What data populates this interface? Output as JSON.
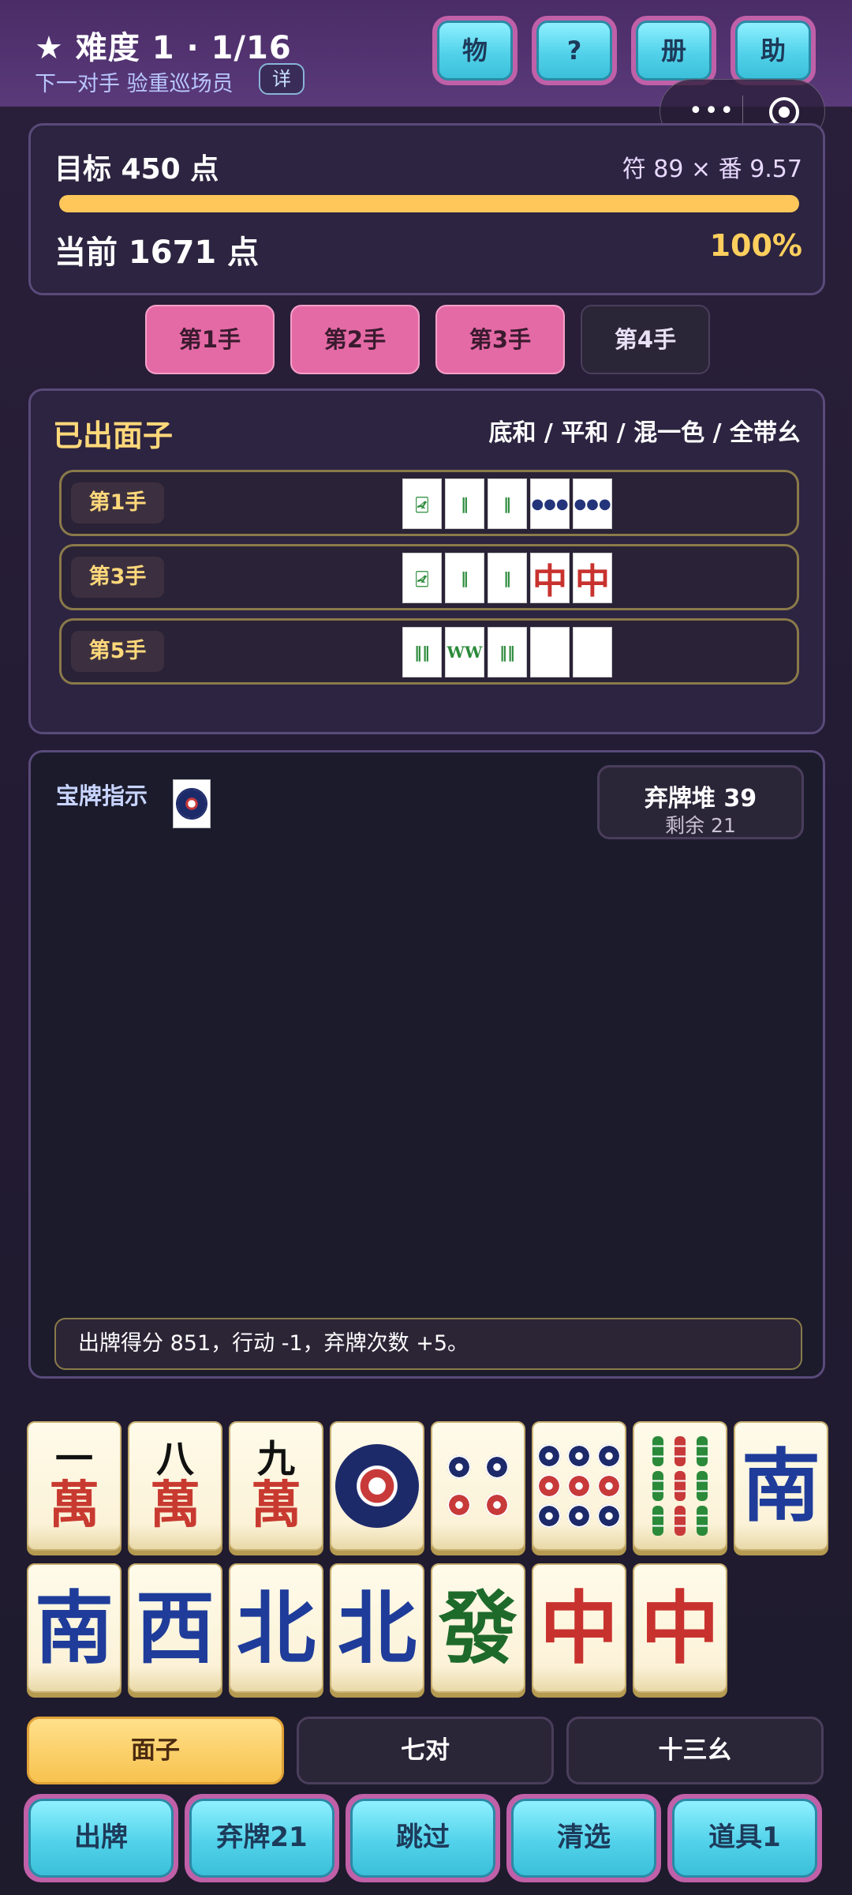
{
  "header": {
    "title": "★ 难度 1 · 1/16",
    "subtitle": "下一对手 验重巡场员",
    "detail_badge": "详",
    "buttons": [
      "物",
      "?",
      "册",
      "助"
    ]
  },
  "score": {
    "goal": "目标 450 点",
    "formula": "符 89 × 番 9.57",
    "current": "当前 1671 点",
    "percent": "100%",
    "progress_fraction": 1.0,
    "progress_color": "#ffc75a"
  },
  "hand_tabs": [
    {
      "label": "第1手",
      "active": true
    },
    {
      "label": "第2手",
      "active": true
    },
    {
      "label": "第3手",
      "active": true
    },
    {
      "label": "第4手",
      "active": false
    }
  ],
  "melds": {
    "title": "已出面子",
    "yaku": "底和 / 平和 / 混一色 / 全带幺",
    "rows": [
      {
        "hand": "第1手",
        "tiles": [
          "bamboo-1",
          "bamboo-2",
          "bamboo-2",
          "circle-9",
          "circle-9"
        ]
      },
      {
        "hand": "第3手",
        "tiles": [
          "bamboo-1",
          "bamboo-2",
          "bamboo-2",
          "中",
          "中"
        ]
      },
      {
        "hand": "第5手",
        "tiles": [
          "bamboo-6",
          "bamboo-8",
          "bamboo-7",
          "white-dragon",
          "white-dragon"
        ]
      }
    ]
  },
  "discard": {
    "dora_label": "宝牌指示",
    "pile_main": "弃牌堆 39",
    "pile_sub": "剩余 21",
    "log": "出牌得分 851，行动 -1，弃牌次数 +5。"
  },
  "hand": {
    "row1": [
      {
        "kind": "man",
        "num": "一",
        "suit": "萬"
      },
      {
        "kind": "man",
        "num": "八",
        "suit": "萬"
      },
      {
        "kind": "man",
        "num": "九",
        "suit": "萬"
      },
      {
        "kind": "circle1",
        "name": "circle-1"
      },
      {
        "kind": "circle4",
        "name": "circle-4"
      },
      {
        "kind": "circle9",
        "name": "circle-9"
      },
      {
        "kind": "bamboo9",
        "name": "bamboo-9"
      },
      {
        "kind": "honor",
        "text": "南",
        "color": "blue"
      }
    ],
    "row2": [
      {
        "kind": "honor",
        "text": "南",
        "color": "blue"
      },
      {
        "kind": "honor",
        "text": "西",
        "color": "blue"
      },
      {
        "kind": "honor",
        "text": "北",
        "color": "blue"
      },
      {
        "kind": "honor",
        "text": "北",
        "color": "blue"
      },
      {
        "kind": "honor",
        "text": "發",
        "color": "green"
      },
      {
        "kind": "honor",
        "text": "中",
        "color": "red"
      },
      {
        "kind": "honor",
        "text": "中",
        "color": "red"
      }
    ]
  },
  "modes": [
    {
      "label": "面子",
      "active": true
    },
    {
      "label": "七对",
      "active": false
    },
    {
      "label": "十三幺",
      "active": false
    }
  ],
  "actions": [
    "出牌",
    "弃牌21",
    "跳过",
    "清选",
    "道具1"
  ]
}
